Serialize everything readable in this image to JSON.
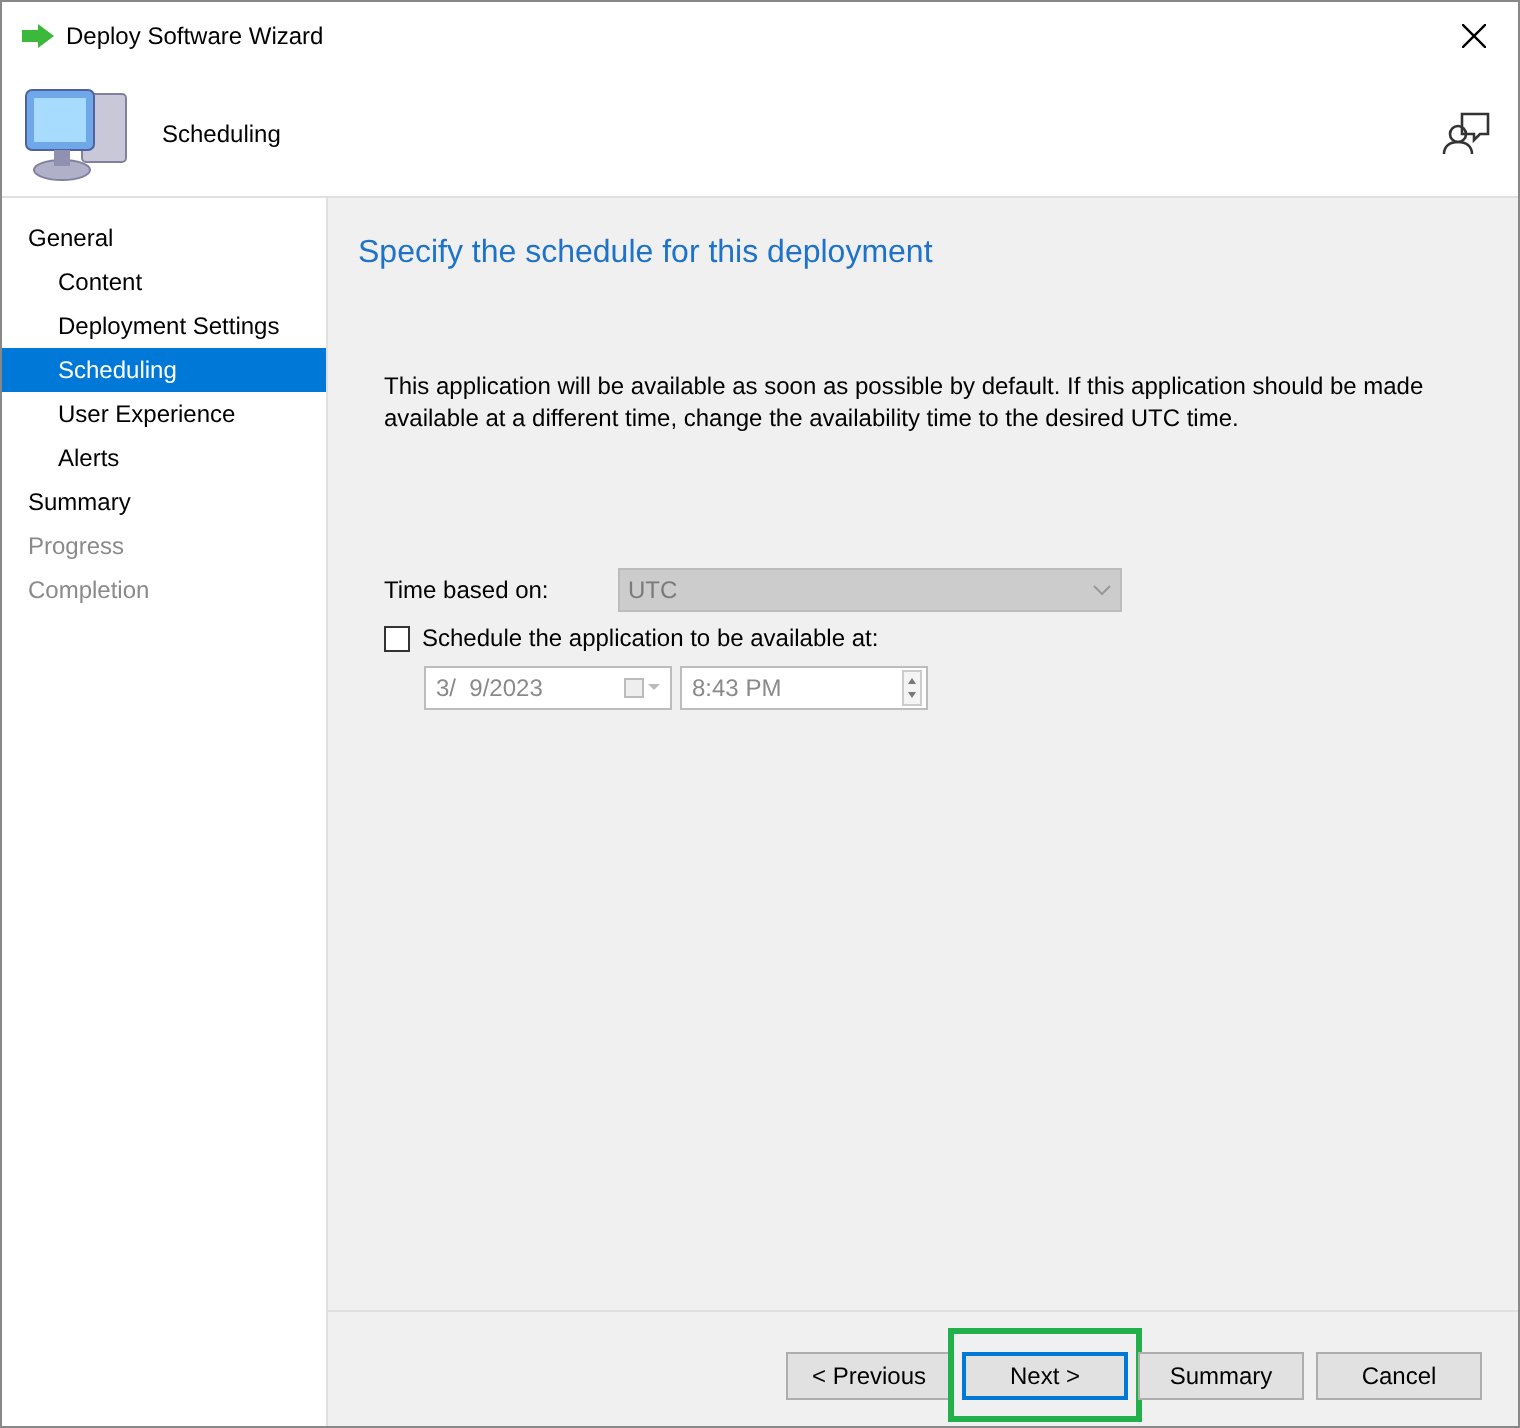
{
  "window": {
    "title": "Deploy Software Wizard"
  },
  "header": {
    "title": "Scheduling"
  },
  "nav": [
    {
      "label": "General",
      "selected": false,
      "disabled": false,
      "children": [
        {
          "label": "Content",
          "selected": false,
          "disabled": false
        },
        {
          "label": "Deployment Settings",
          "selected": false,
          "disabled": false
        },
        {
          "label": "Scheduling",
          "selected": true,
          "disabled": false
        },
        {
          "label": "User Experience",
          "selected": false,
          "disabled": false
        },
        {
          "label": "Alerts",
          "selected": false,
          "disabled": false
        }
      ]
    },
    {
      "label": "Summary",
      "selected": false,
      "disabled": false
    },
    {
      "label": "Progress",
      "selected": false,
      "disabled": true
    },
    {
      "label": "Completion",
      "selected": false,
      "disabled": true
    }
  ],
  "content": {
    "heading": "Specify the schedule for this deployment",
    "description": "This application will be available as soon as possible by default. If this application should be made available at a different time, change the availability time to the desired UTC time.",
    "time_based_on": {
      "label": "Time based on:",
      "value": "UTC",
      "disabled": true
    },
    "schedule_checkbox": {
      "label": "Schedule the application to be available at:",
      "checked": false
    },
    "date": {
      "value": "3/  9/2023"
    },
    "time": {
      "value": "8:43 PM"
    }
  },
  "buttons": [
    {
      "label": "< Previous",
      "focused": false,
      "highlighted": false
    },
    {
      "label": "Next >",
      "focused": true,
      "highlighted": true
    },
    {
      "label": "Summary",
      "focused": false,
      "highlighted": false
    },
    {
      "label": "Cancel",
      "focused": false,
      "highlighted": false
    }
  ]
}
